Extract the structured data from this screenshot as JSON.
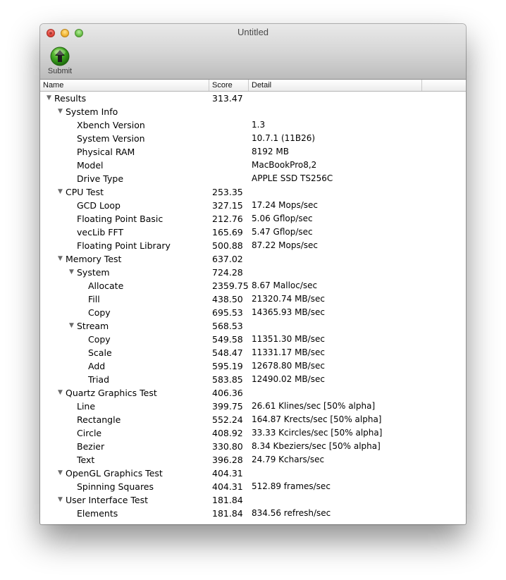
{
  "window": {
    "title": "Untitled",
    "toolbar": {
      "submit_label": "Submit",
      "submit_icon": "green-up-arrow-icon"
    }
  },
  "table": {
    "columns": {
      "name": "Name",
      "score": "Score",
      "detail": "Detail"
    },
    "rows": [
      {
        "name": "Results",
        "score": "313.47",
        "detail": "",
        "level": 0,
        "expandable": true,
        "expanded": true
      },
      {
        "name": "System Info",
        "score": "",
        "detail": "",
        "level": 1,
        "expandable": true,
        "expanded": true
      },
      {
        "name": "Xbench Version",
        "score": "",
        "detail": "1.3",
        "level": 2,
        "expandable": false
      },
      {
        "name": "System Version",
        "score": "",
        "detail": "10.7.1 (11B26)",
        "level": 2,
        "expandable": false
      },
      {
        "name": "Physical RAM",
        "score": "",
        "detail": "8192 MB",
        "level": 2,
        "expandable": false
      },
      {
        "name": "Model",
        "score": "",
        "detail": "MacBookPro8,2",
        "level": 2,
        "expandable": false
      },
      {
        "name": "Drive Type",
        "score": "",
        "detail": "APPLE SSD TS256C",
        "level": 2,
        "expandable": false
      },
      {
        "name": "CPU Test",
        "score": "253.35",
        "detail": "",
        "level": 1,
        "expandable": true,
        "expanded": true
      },
      {
        "name": "GCD Loop",
        "score": "327.15",
        "detail": "17.24 Mops/sec",
        "level": 2,
        "expandable": false
      },
      {
        "name": "Floating Point Basic",
        "score": "212.76",
        "detail": "5.06 Gflop/sec",
        "level": 2,
        "expandable": false
      },
      {
        "name": "vecLib FFT",
        "score": "165.69",
        "detail": "5.47 Gflop/sec",
        "level": 2,
        "expandable": false
      },
      {
        "name": "Floating Point Library",
        "score": "500.88",
        "detail": "87.22 Mops/sec",
        "level": 2,
        "expandable": false
      },
      {
        "name": "Memory Test",
        "score": "637.02",
        "detail": "",
        "level": 1,
        "expandable": true,
        "expanded": true
      },
      {
        "name": "System",
        "score": "724.28",
        "detail": "",
        "level": 2,
        "expandable": true,
        "expanded": true
      },
      {
        "name": "Allocate",
        "score": "2359.75",
        "detail": "8.67 Malloc/sec",
        "level": 3,
        "expandable": false
      },
      {
        "name": "Fill",
        "score": "438.50",
        "detail": "21320.74 MB/sec",
        "level": 3,
        "expandable": false
      },
      {
        "name": "Copy",
        "score": "695.53",
        "detail": "14365.93 MB/sec",
        "level": 3,
        "expandable": false
      },
      {
        "name": "Stream",
        "score": "568.53",
        "detail": "",
        "level": 2,
        "expandable": true,
        "expanded": true
      },
      {
        "name": "Copy",
        "score": "549.58",
        "detail": "11351.30 MB/sec",
        "level": 3,
        "expandable": false
      },
      {
        "name": "Scale",
        "score": "548.47",
        "detail": "11331.17 MB/sec",
        "level": 3,
        "expandable": false
      },
      {
        "name": "Add",
        "score": "595.19",
        "detail": "12678.80 MB/sec",
        "level": 3,
        "expandable": false
      },
      {
        "name": "Triad",
        "score": "583.85",
        "detail": "12490.02 MB/sec",
        "level": 3,
        "expandable": false
      },
      {
        "name": "Quartz Graphics Test",
        "score": "406.36",
        "detail": "",
        "level": 1,
        "expandable": true,
        "expanded": true
      },
      {
        "name": "Line",
        "score": "399.75",
        "detail": "26.61 Klines/sec [50% alpha]",
        "level": 2,
        "expandable": false
      },
      {
        "name": "Rectangle",
        "score": "552.24",
        "detail": "164.87 Krects/sec [50% alpha]",
        "level": 2,
        "expandable": false
      },
      {
        "name": "Circle",
        "score": "408.92",
        "detail": "33.33 Kcircles/sec [50% alpha]",
        "level": 2,
        "expandable": false
      },
      {
        "name": "Bezier",
        "score": "330.80",
        "detail": "8.34 Kbeziers/sec [50% alpha]",
        "level": 2,
        "expandable": false
      },
      {
        "name": "Text",
        "score": "396.28",
        "detail": "24.79 Kchars/sec",
        "level": 2,
        "expandable": false
      },
      {
        "name": "OpenGL Graphics Test",
        "score": "404.31",
        "detail": "",
        "level": 1,
        "expandable": true,
        "expanded": true
      },
      {
        "name": "Spinning Squares",
        "score": "404.31",
        "detail": "512.89 frames/sec",
        "level": 2,
        "expandable": false
      },
      {
        "name": "User Interface Test",
        "score": "181.84",
        "detail": "",
        "level": 1,
        "expandable": true,
        "expanded": true
      },
      {
        "name": "Elements",
        "score": "181.84",
        "detail": "834.56 refresh/sec",
        "level": 2,
        "expandable": false
      }
    ]
  }
}
